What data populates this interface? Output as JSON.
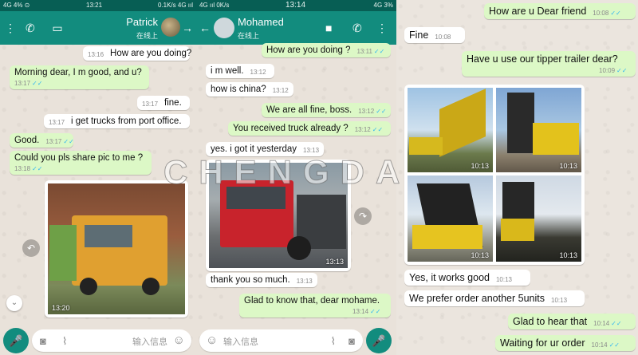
{
  "colors": {
    "header_dark": "#075e54",
    "header": "#128c7e",
    "outgoing": "#dcf8c6",
    "incoming": "#ffffff",
    "read_tick": "#34b7f1"
  },
  "watermark": "CHENGDA",
  "chat1": {
    "status": {
      "left": "4G 4% ⊙",
      "time": "13:21",
      "right": "0.1K/s 4G ııl"
    },
    "contact": {
      "name": "Patrick",
      "status": "在线上"
    },
    "messages": [
      {
        "text": "How are you doing?",
        "time": "13:16"
      },
      {
        "text": "Morning dear, I m good, and u?",
        "time": "13:17"
      },
      {
        "text": "fine.",
        "time": "13:17"
      },
      {
        "text": "i get trucks from port office.",
        "time": "13:17"
      },
      {
        "text": "Good.",
        "time": "13:17"
      },
      {
        "text": "Could you pls share pic to me ?",
        "time": "13:18"
      }
    ],
    "photo_time": "13:20",
    "input_placeholder": "输入信息"
  },
  "chat2": {
    "status": {
      "left": "4G ııl 0K/s",
      "time": "13:14",
      "right": "4G 3%"
    },
    "contact": {
      "name": "Mohamed",
      "status": "在线上"
    },
    "messages": [
      {
        "text": "How are you doing ?",
        "time": "13:11"
      },
      {
        "text": "i m well.",
        "time": "13:12"
      },
      {
        "text": "how is china?",
        "time": "13:12"
      },
      {
        "text": "We are all fine, boss.",
        "time": "13:12"
      },
      {
        "text": "You received truck already ?",
        "time": "13:12"
      },
      {
        "text": "yes. i got it yesterday",
        "time": "13:13"
      },
      {
        "text": "thank you so much.",
        "time": "13:13"
      },
      {
        "text": "Glad to know that, dear mohame.",
        "time": "13:14"
      }
    ],
    "photo_time": "13:13",
    "input_placeholder": "输入信息"
  },
  "chat3": {
    "messages": [
      {
        "text": "How are u Dear friend",
        "time": "10:08"
      },
      {
        "text": "Fine",
        "time": "10:08"
      },
      {
        "text": "Have u use our tipper trailer dear?",
        "time": "10:09"
      },
      {
        "text": "Yes, it works good",
        "time": "10:13"
      },
      {
        "text": "We prefer order another 5units",
        "time": "10:13"
      },
      {
        "text": "Glad to hear that",
        "time": "10:14"
      },
      {
        "text": "Waiting for ur order",
        "time": "10:14"
      }
    ],
    "photo_times": [
      "10:13",
      "10:13",
      "10:13",
      "10:13"
    ]
  }
}
